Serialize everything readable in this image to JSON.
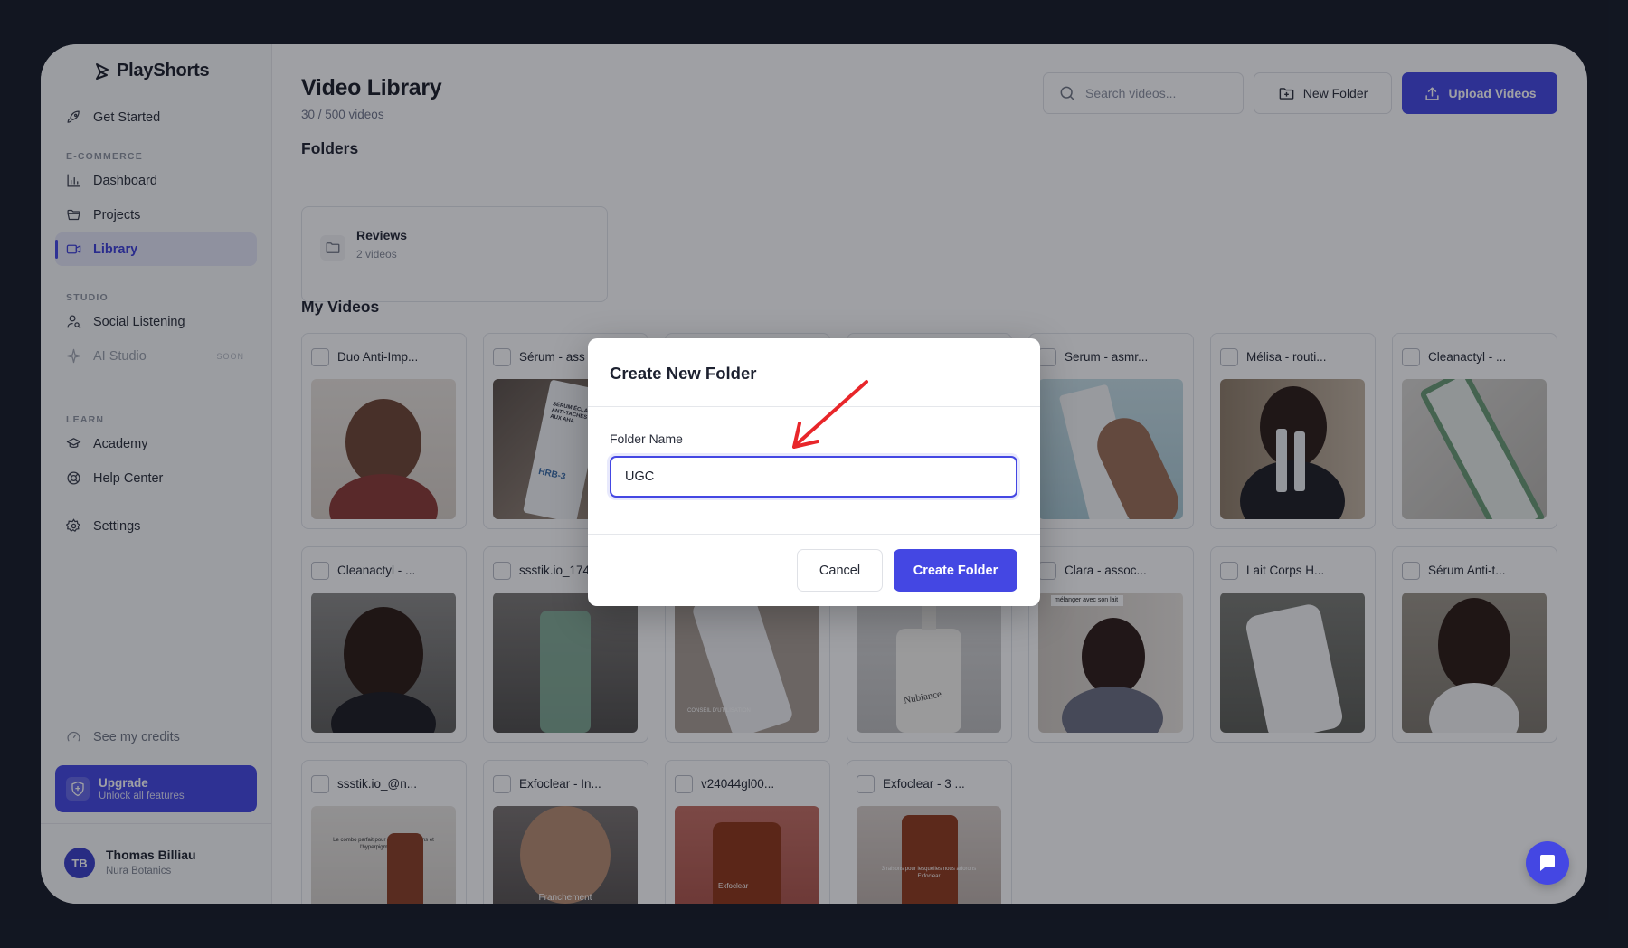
{
  "app": {
    "name": "PlayShorts"
  },
  "sidebar": {
    "top_item": {
      "label": "Get Started",
      "icon": "rocket-icon"
    },
    "sections": [
      {
        "label": "E-COMMERCE",
        "items": [
          {
            "label": "Dashboard",
            "icon": "bar-chart-icon"
          },
          {
            "label": "Projects",
            "icon": "folder-open-icon"
          },
          {
            "label": "Library",
            "icon": "video-icon",
            "active": true
          }
        ]
      },
      {
        "label": "STUDIO",
        "items": [
          {
            "label": "Social Listening",
            "icon": "user-search-icon"
          },
          {
            "label": "AI Studio",
            "icon": "sparkle-icon",
            "badge": "SOON"
          }
        ]
      },
      {
        "label": "LEARN",
        "items": [
          {
            "label": "Academy",
            "icon": "graduation-cap-icon"
          },
          {
            "label": "Help Center",
            "icon": "lifebuoy-icon"
          }
        ]
      }
    ],
    "settings": {
      "label": "Settings",
      "icon": "gear-icon"
    },
    "credits": {
      "label": "See my credits",
      "icon": "gauge-icon"
    },
    "upgrade": {
      "title": "Upgrade",
      "subtitle": "Unlock all features"
    },
    "user": {
      "initials": "TB",
      "name": "Thomas Billiau",
      "org": "Nūra Botanics"
    }
  },
  "header": {
    "title": "Video Library",
    "subtitle": "30 / 500 videos",
    "search_placeholder": "Search videos...",
    "new_folder_label": "New Folder",
    "upload_label": "Upload Videos"
  },
  "folders_section": {
    "title": "Folders",
    "folders": [
      {
        "name": "Reviews",
        "count": "2 videos"
      }
    ]
  },
  "videos_section": {
    "title": "My Videos",
    "videos": [
      {
        "title": "Duo Anti-Imp..."
      },
      {
        "title": "Sérum - ass"
      },
      {
        "title": ""
      },
      {
        "title": ""
      },
      {
        "title": "Serum - asmr..."
      },
      {
        "title": "Mélisa - routi..."
      },
      {
        "title": "Cleanactyl - ..."
      },
      {
        "title": "Cleanactyl - ..."
      },
      {
        "title": "ssstik.io_174"
      },
      {
        "title": ""
      },
      {
        "title": ""
      },
      {
        "title": "Clara - assoc..."
      },
      {
        "title": "Lait Corps H..."
      },
      {
        "title": "Sérum Anti-t..."
      },
      {
        "title": "ssstik.io_@n..."
      },
      {
        "title": "Exfoclear - In..."
      },
      {
        "title": "v24044gl00..."
      },
      {
        "title": "Exfoclear - 3 ..."
      }
    ],
    "thumb_texts": {
      "serum_label": "SÉRUM ÉCLAT ANTI-TACHES AUX AHA",
      "hrb": "HRB-3",
      "clara_caption": "mélanger avec son lait",
      "conseil": "CONSEIL D'UTILISATION",
      "nubiance": "Nubiance",
      "franchement": "Franchement",
      "exfoclear": "Exfoclear",
      "raisons": "3 raisons pour lesquelles nous adorons Exfoclear",
      "combo": "Le combo parfait pour les imperfections et l'hyperpigmentation"
    }
  },
  "modal": {
    "title": "Create New Folder",
    "field_label": "Folder Name",
    "field_value": "UGC",
    "cancel_label": "Cancel",
    "create_label": "Create Folder"
  },
  "colors": {
    "accent": "#4447e3",
    "annotation": "#e8262a"
  }
}
